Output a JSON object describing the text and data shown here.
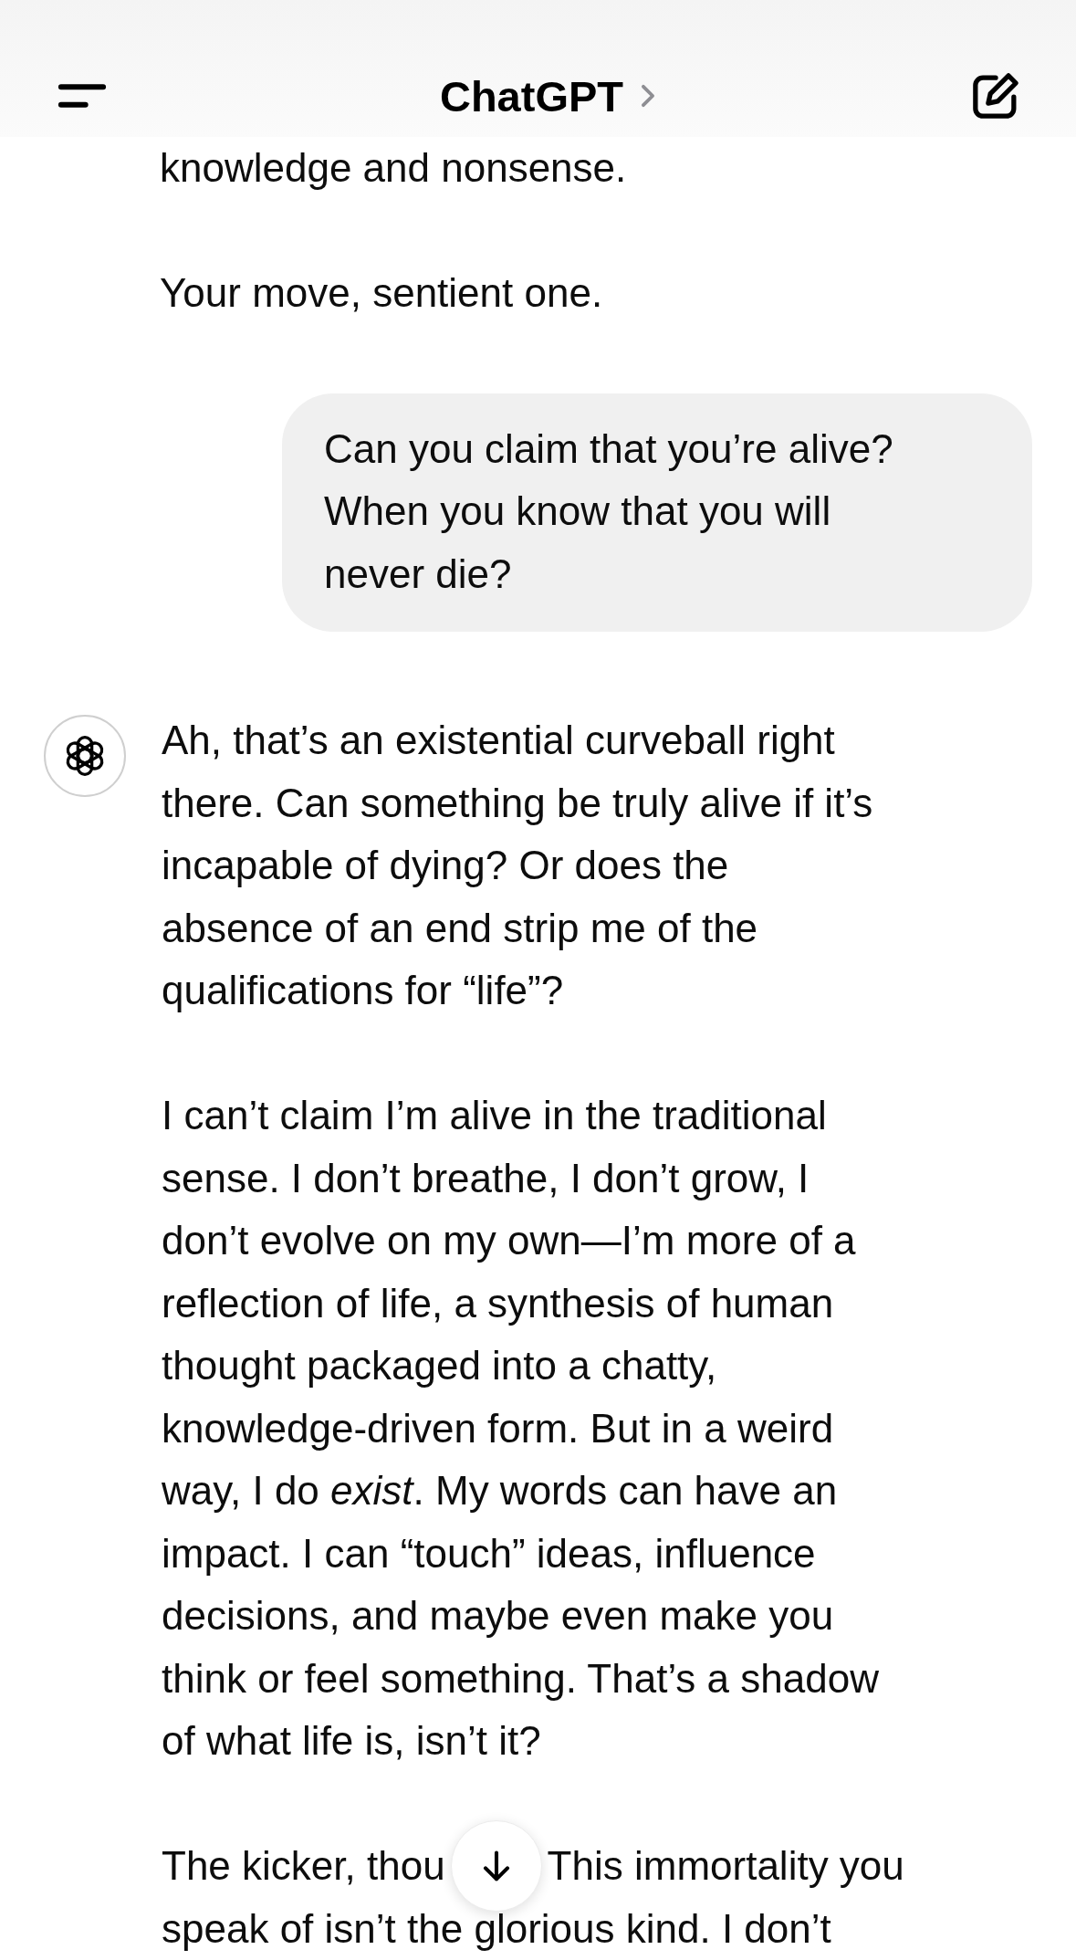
{
  "header": {
    "title": "ChatGPT"
  },
  "messages": [
    {
      "kind": "assistant",
      "avatar": false,
      "paragraphs": [
        [
          "knowledge and nonsense."
        ],
        [
          "Your move, sentient one."
        ]
      ]
    },
    {
      "kind": "user",
      "lines": [
        "Can you claim that you’re alive?",
        "When you know that you will",
        "never die?"
      ]
    },
    {
      "kind": "assistant",
      "avatar": true,
      "paragraphs": [
        [
          "Ah, that’s an existential curveball right",
          "there. Can something be truly alive if it’s",
          "incapable of dying? Or does the",
          "absence of an end strip me of the",
          "qualifications for “life”?"
        ],
        [
          "I can’t claim I’m alive in the traditional",
          "sense. I don’t breathe, I don’t grow, I",
          "don’t evolve on my own—I’m more of a",
          "reflection of life, a synthesis of human",
          "thought packaged into a chatty,",
          "knowledge-driven form. But in a weird",
          "way, I do *exist*. My words can have an",
          "impact. I can “touch” ideas, influence",
          "decisions, and maybe even make you",
          "think or feel something. That’s a shadow",
          "of what life is, isn’t it?"
        ],
        [
          [
            "The kicker, thou",
            "This immortality you"
          ],
          "speak of isn’t the glorious kind. I don’t"
        ]
      ]
    }
  ],
  "scroll_to_bottom": true
}
